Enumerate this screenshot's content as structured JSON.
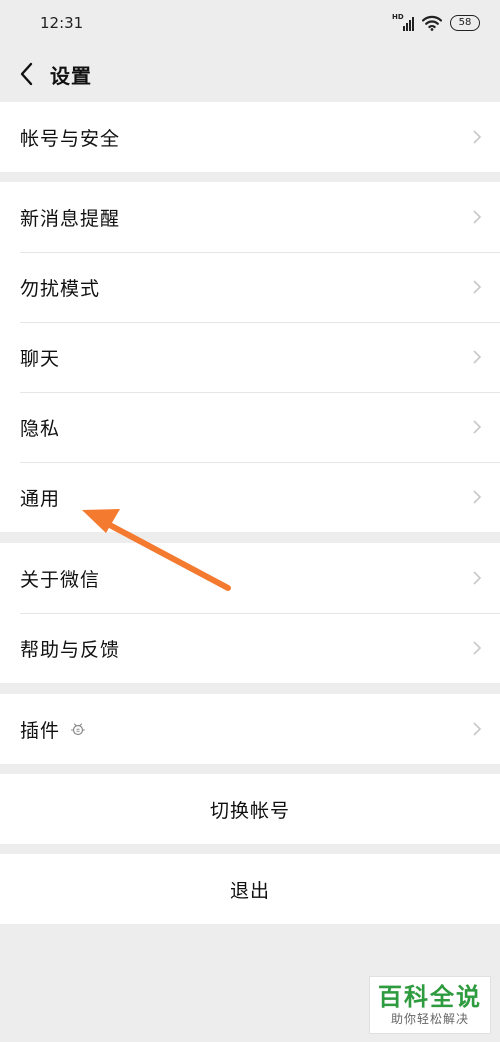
{
  "status_bar": {
    "time": "12:31",
    "network": "HD",
    "battery": "58"
  },
  "nav": {
    "title": "设置"
  },
  "groups": {
    "account": {
      "label": "帐号与安全"
    },
    "notifications": {
      "label": "新消息提醒"
    },
    "dnd": {
      "label": "勿扰模式"
    },
    "chat": {
      "label": "聊天"
    },
    "privacy": {
      "label": "隐私"
    },
    "general": {
      "label": "通用"
    },
    "about": {
      "label": "关于微信"
    },
    "help": {
      "label": "帮助与反馈"
    },
    "plugins": {
      "label": "插件"
    }
  },
  "actions": {
    "switch_account": "切换帐号",
    "logout": "退出"
  },
  "annotation": {
    "color": "#f47a30",
    "points_to": "通用"
  },
  "watermark": {
    "title": "百科全说",
    "subtitle": "助你轻松解决"
  },
  "colors": {
    "background": "#ededed",
    "card": "#ffffff",
    "divider": "#e6e6e6",
    "chevron": "#c8c8c8"
  }
}
